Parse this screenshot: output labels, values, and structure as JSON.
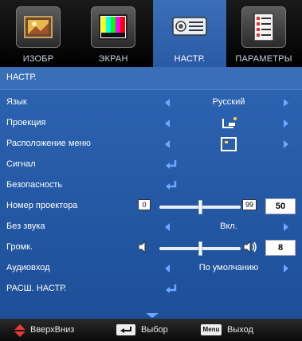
{
  "tabs": [
    {
      "label": "ИЗОБР",
      "icon": "image-tab-icon"
    },
    {
      "label": "ЭКРАН",
      "icon": "screen-tab-icon"
    },
    {
      "label": "НАСТР.",
      "icon": "setup-tab-icon",
      "active": true
    },
    {
      "label": "ПАРАМЕТРЫ",
      "icon": "options-tab-icon"
    }
  ],
  "title": "НАСТР.",
  "rows": {
    "language": {
      "label": "Язык",
      "value": "Русский"
    },
    "projection": {
      "label": "Проекция",
      "value_icon": "projection-mode-icon"
    },
    "menu_location": {
      "label": "Расположение меню",
      "value_icon": "menu-location-icon"
    },
    "signal": {
      "label": "Сигнал"
    },
    "security": {
      "label": "Безопасность"
    },
    "projector_id": {
      "label": "Номер проектора",
      "min": "0",
      "max": "99",
      "value": "50"
    },
    "mute": {
      "label": "Без звука",
      "value": "Вкл."
    },
    "volume": {
      "label": "Громк.",
      "value": "8"
    },
    "audio_input": {
      "label": "Аудиовход",
      "value": "По умолчанию"
    },
    "advanced": {
      "label": "РАСШ. НАСТР."
    }
  },
  "footer": {
    "nav_label": "ВверхВниз",
    "select_label": "Выбор",
    "menu_key": "Menu",
    "exit_label": "Выход"
  },
  "colors": {
    "panel": "#255aa6",
    "accent": "#6ea8ff",
    "active_tab": "#3b6eb8"
  }
}
